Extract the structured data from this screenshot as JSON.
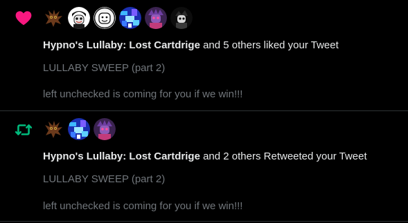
{
  "notifications": [
    {
      "type": "like",
      "type_icon": "heart-icon",
      "icon_color": "#f91880",
      "actor": "Hypno's Lullaby: Lost Cartdrige",
      "action_text": " and 5 others liked your Tweet",
      "tweet_title": "LULLABY SWEEP (part 2)",
      "tweet_body": "left unchecked is coming for you if we win!!!",
      "avatars": [
        "avatar-creature",
        "avatar-bw-character",
        "avatar-white-face",
        "avatar-blue-glitch",
        "avatar-purple-character",
        "avatar-dark-character"
      ]
    },
    {
      "type": "retweet",
      "type_icon": "retweet-icon",
      "icon_color": "#00ba7c",
      "actor": "Hypno's Lullaby: Lost Cartdrige",
      "action_text": " and 2 others Retweeted your Tweet",
      "tweet_title": "LULLABY SWEEP (part 2)",
      "tweet_body": "left unchecked is coming for you if we win!!!",
      "avatars": [
        "avatar-creature",
        "avatar-blue-glitch",
        "avatar-purple-character"
      ]
    }
  ]
}
